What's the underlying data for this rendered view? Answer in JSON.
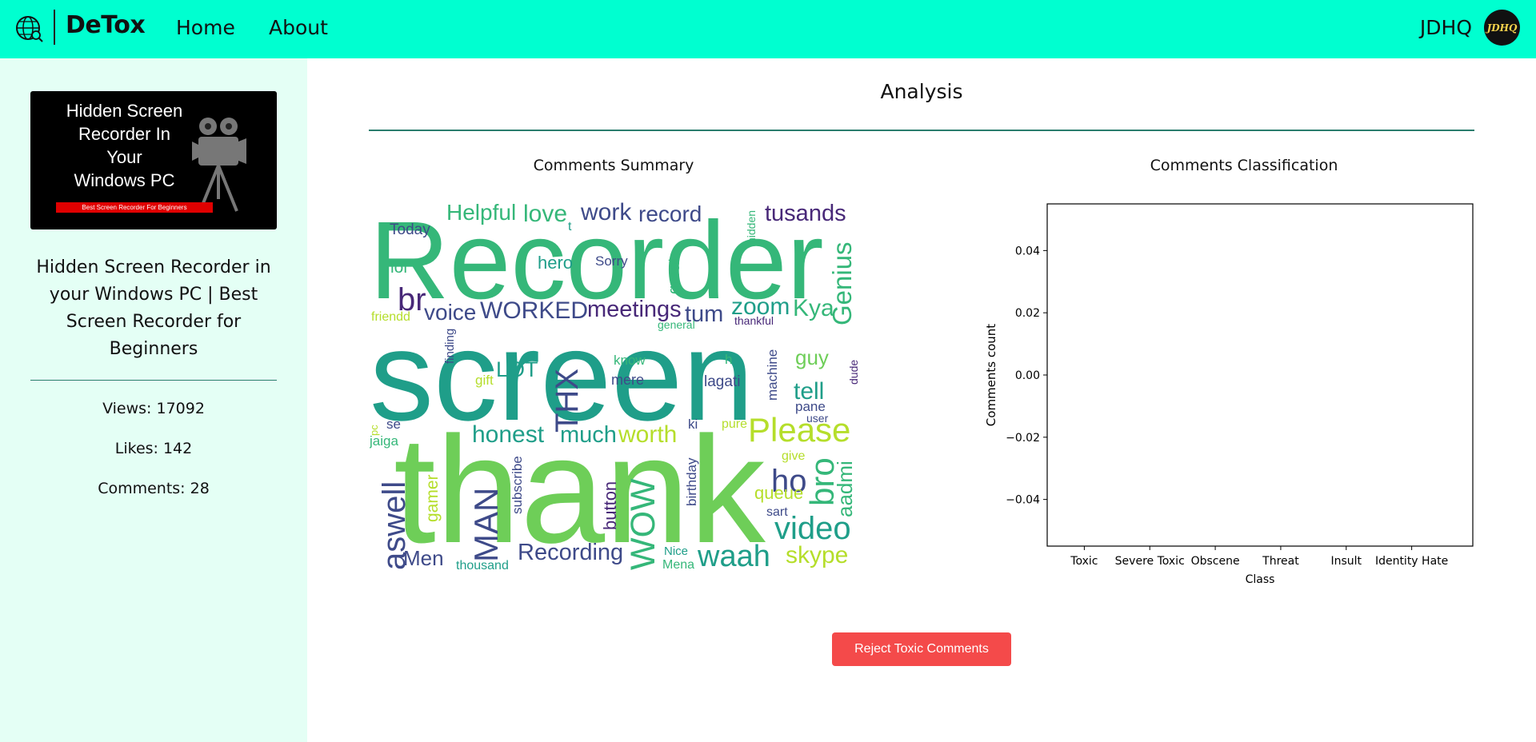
{
  "nav": {
    "brand": "DeTox",
    "links": [
      "Home",
      "About"
    ],
    "user": "JDHQ",
    "avatar_text": "JDHQ"
  },
  "video": {
    "thumbnail_text": [
      "Hidden Screen",
      "Recorder In",
      "Your",
      "Windows PC"
    ],
    "thumbnail_banner": "Best Screen Recorder For Beginners",
    "title_lines": [
      "Hidden Screen Recorder in",
      "your Windows PC | Best",
      "Screen Recorder for",
      "Beginners"
    ],
    "title": "Hidden Screen Recorder in your Windows PC | Best Screen Recorder for Beginners",
    "views_label": "Views: 17092",
    "likes_label": "Likes: 142",
    "comments_label": "Comments: 28"
  },
  "analysis": {
    "title": "Analysis",
    "summary_title": "Comments Summary",
    "classification_title": "Comments Classification",
    "reject_button": "Reject Toxic Comments"
  },
  "wordcloud": {
    "words": [
      "Recorder",
      "screen",
      "thank",
      "Helpful",
      "love",
      "work",
      "record",
      "tusands",
      "Today",
      "hidden",
      "t",
      "hero",
      "Sorry",
      "great",
      "Genius",
      "lol",
      "br",
      "voice",
      "WORKED",
      "meetings",
      "tum",
      "zoom",
      "Kya",
      "friendd",
      "general",
      "thankful",
      "finding",
      "LOT",
      "THX",
      "know",
      "h",
      "machine",
      "guy",
      "dude",
      "gift",
      "mere",
      "lagati",
      "tell",
      "pane",
      "user",
      "pc",
      "se",
      "jaiga",
      "honest",
      "much",
      "worth",
      "ki",
      "pure",
      "Please",
      "give",
      "ho",
      "bro",
      "aadmi",
      "aswell",
      "gamer",
      "MAN",
      "subscribe",
      "button",
      "WOW",
      "birthday",
      "queue",
      "sart",
      "video",
      "Men",
      "thousand",
      "Recording",
      "Nice",
      "Mena",
      "waah",
      "skype"
    ],
    "colors": {
      "purple": "#482878",
      "blue": "#3e4a89",
      "teal": "#1f9e89",
      "green": "#35b779",
      "lime": "#6ece58",
      "yellow": "#b5de2b",
      "darkblue": "#31688e"
    }
  },
  "chart_data": {
    "type": "bar",
    "title": "",
    "categories": [
      "Toxic",
      "Severe Toxic",
      "Obscene",
      "Threat",
      "Insult",
      "Identity Hate"
    ],
    "values": [],
    "xlabel": "Class",
    "ylabel": "Comments count",
    "ylim": [
      -0.055,
      0.055
    ],
    "yticks": [
      0.04,
      0.02,
      0.0,
      -0.02,
      -0.04
    ],
    "ytick_labels": [
      "0.04",
      "0.02",
      "0.00",
      "−0.02",
      "−0.04"
    ],
    "grid": false
  },
  "colors": {
    "navbar": "#00ffd0",
    "sidebar": "#e4fff5",
    "divider": "#2a7d6d",
    "reject": "#f44a4a"
  }
}
